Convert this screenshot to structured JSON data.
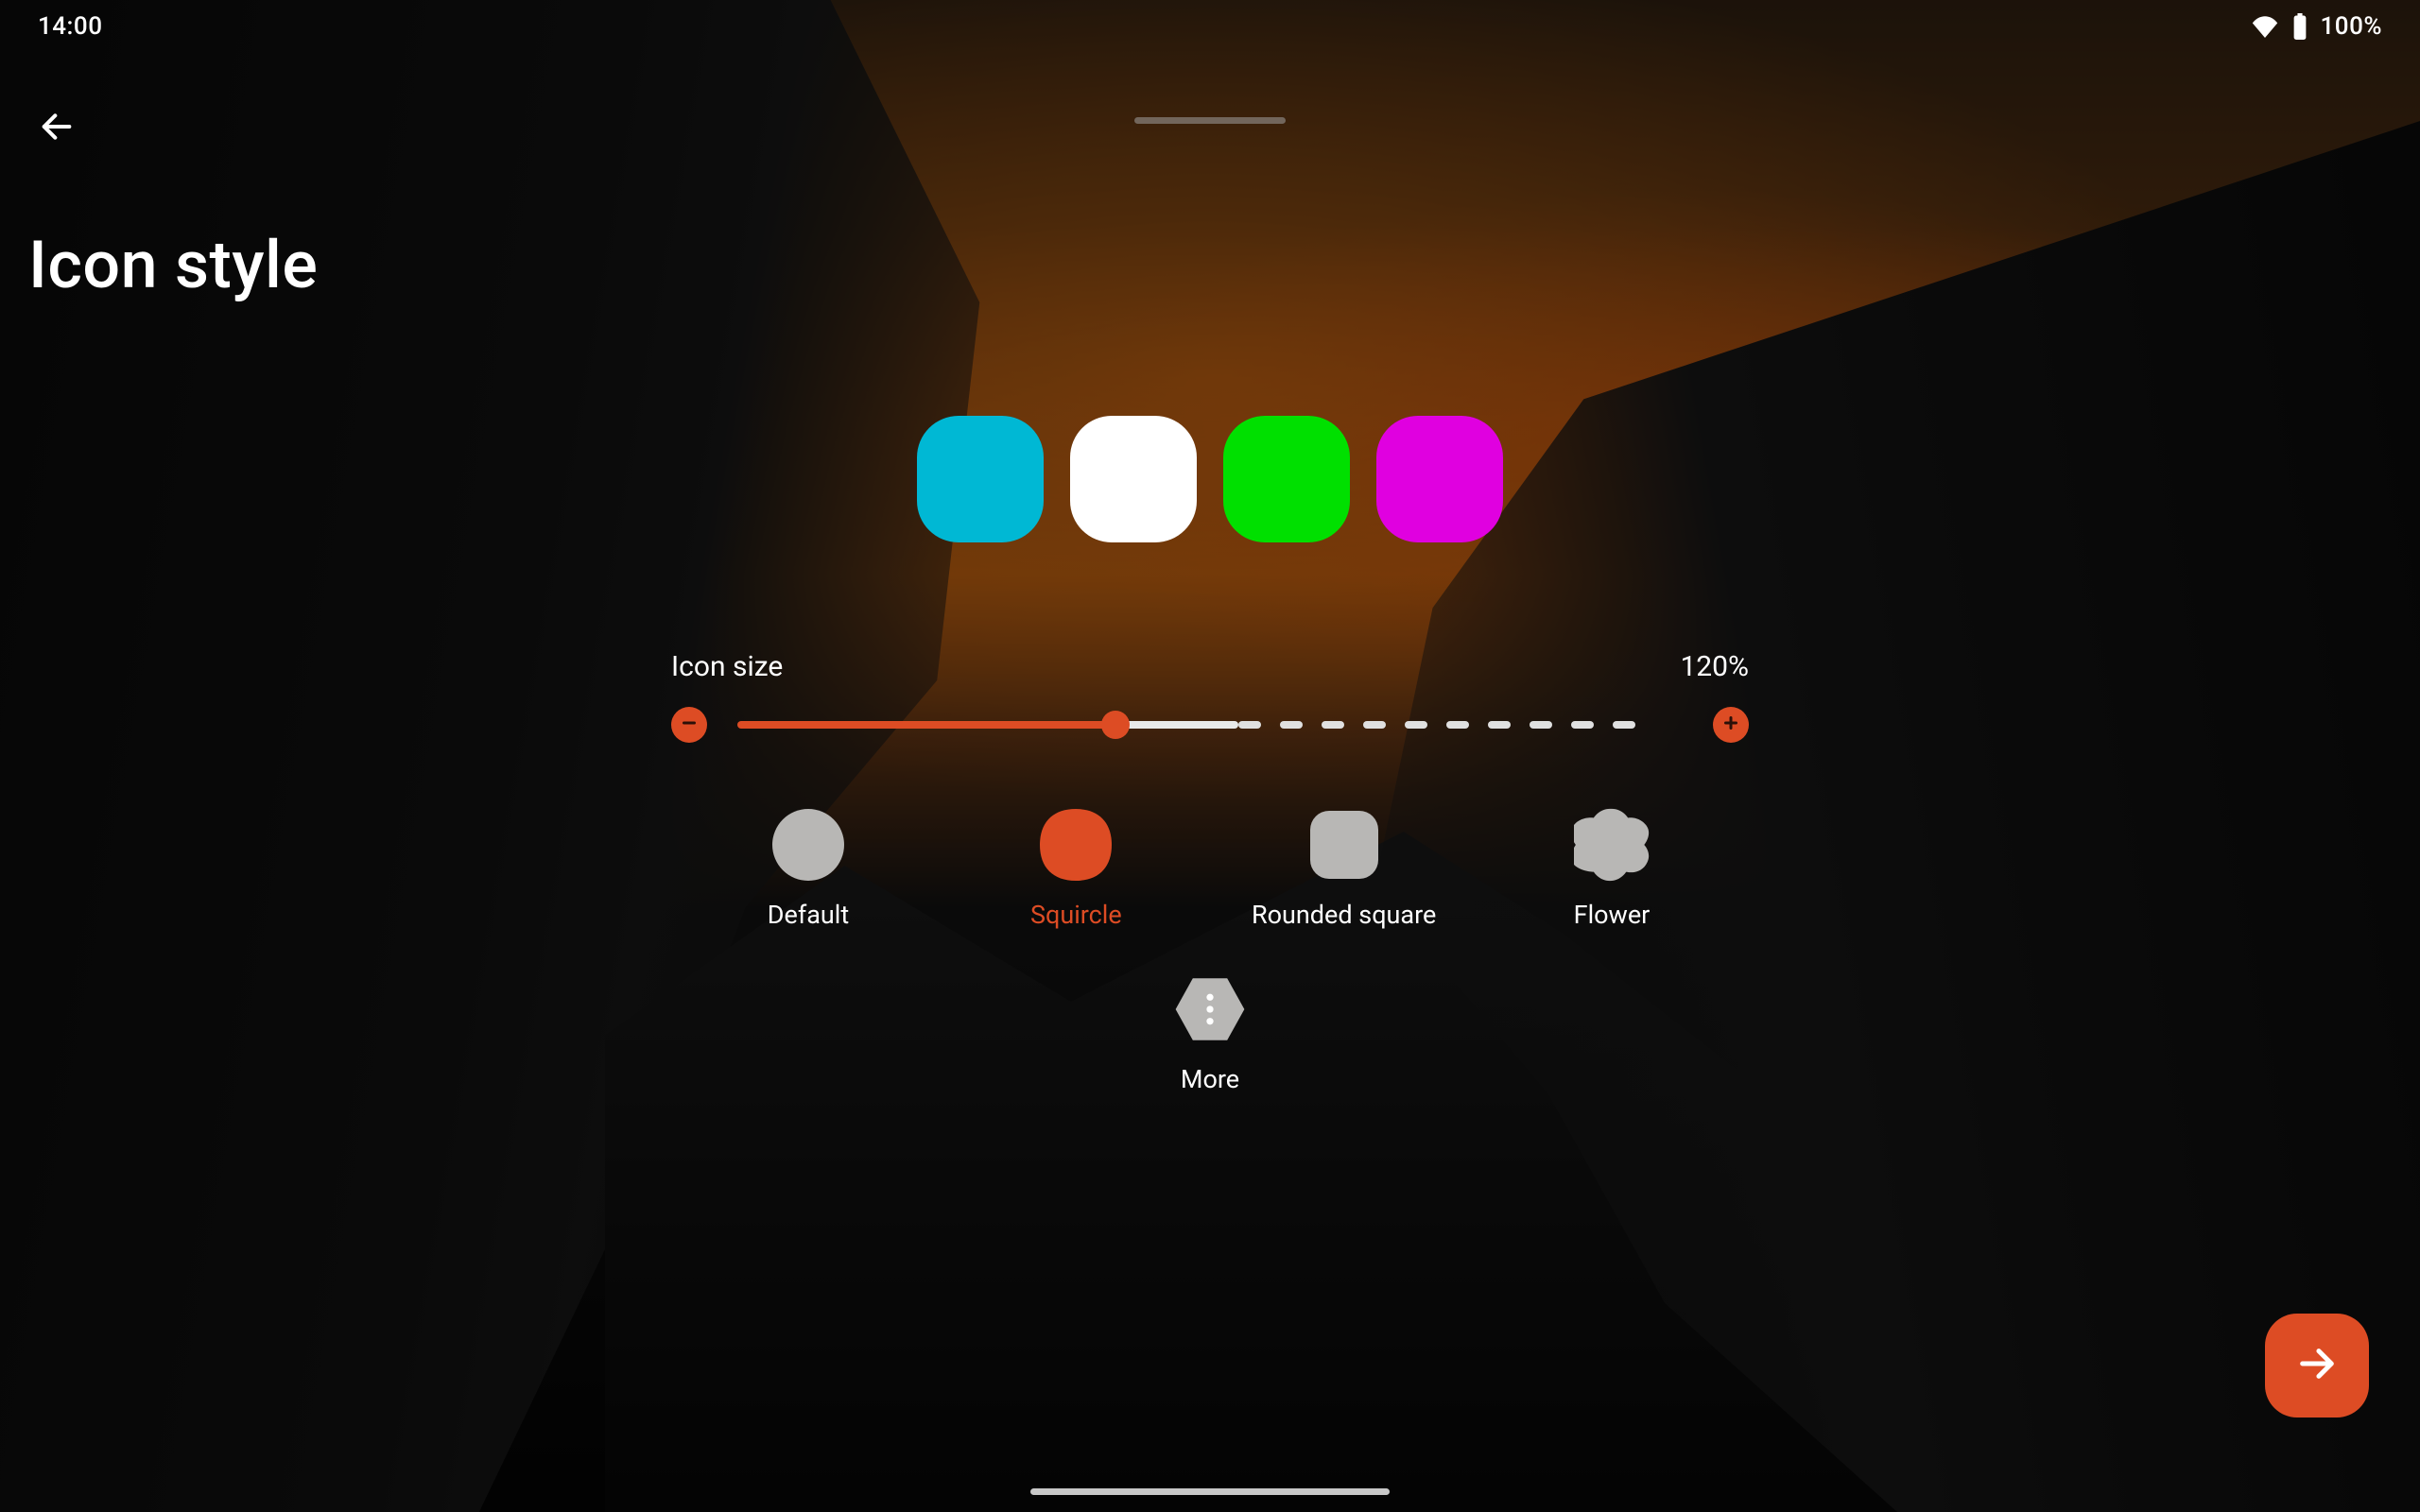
{
  "status": {
    "time": "14:00",
    "battery": "100%"
  },
  "page": {
    "title": "Icon style"
  },
  "samples": [
    {
      "color": "#00b8d4"
    },
    {
      "color": "#ffffff"
    },
    {
      "color": "#00e000"
    },
    {
      "color": "#e000e0"
    }
  ],
  "size": {
    "label": "Icon size",
    "value_label": "120%",
    "percent_of_continuous": 40
  },
  "shapes": {
    "selected": "squircle",
    "items": [
      {
        "id": "default",
        "label": "Default"
      },
      {
        "id": "squircle",
        "label": "Squircle"
      },
      {
        "id": "rounded-square",
        "label": "Rounded square"
      },
      {
        "id": "flower",
        "label": "Flower"
      }
    ],
    "more": {
      "id": "more",
      "label": "More"
    }
  },
  "colors": {
    "accent": "#dd4c24",
    "inactive_shape": "#b8b7b5"
  }
}
